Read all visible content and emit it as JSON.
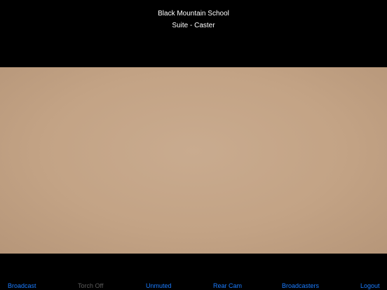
{
  "header": {
    "title": "Black Mountain School",
    "subtitle": "Suite - Caster"
  },
  "toolbar": {
    "broadcast": "Broadcast",
    "torch": "Torch Off",
    "mute": "Unmuted",
    "camera": "Rear Cam",
    "broadcasters": "Broadcasters",
    "logout": "Logout"
  },
  "colors": {
    "background": "#000000",
    "accent": "#1a7cff",
    "disabled": "#5c5c5c",
    "preview": "#c3a385"
  }
}
